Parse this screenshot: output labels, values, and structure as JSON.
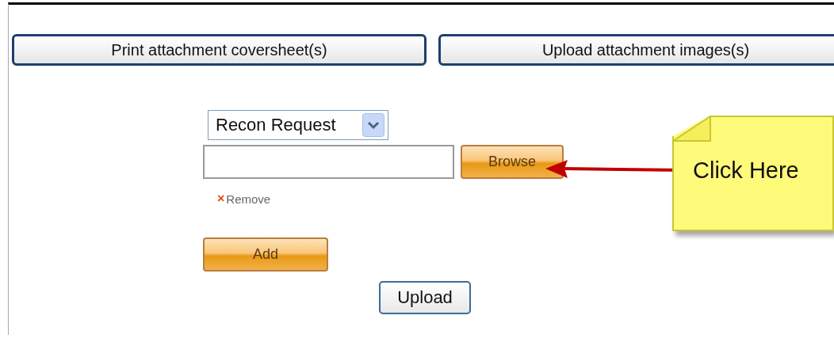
{
  "top_buttons": [
    {
      "label": "Print attachment coversheet(s)"
    },
    {
      "label": "Upload attachment images(s)"
    }
  ],
  "form": {
    "document_type": "Recon Request",
    "browse_button": "Browse",
    "remove_link": {
      "icon": "×",
      "label": "Remove"
    },
    "add_button": "Add",
    "upload_button": "Upload"
  },
  "callout": {
    "text": "Click Here"
  }
}
